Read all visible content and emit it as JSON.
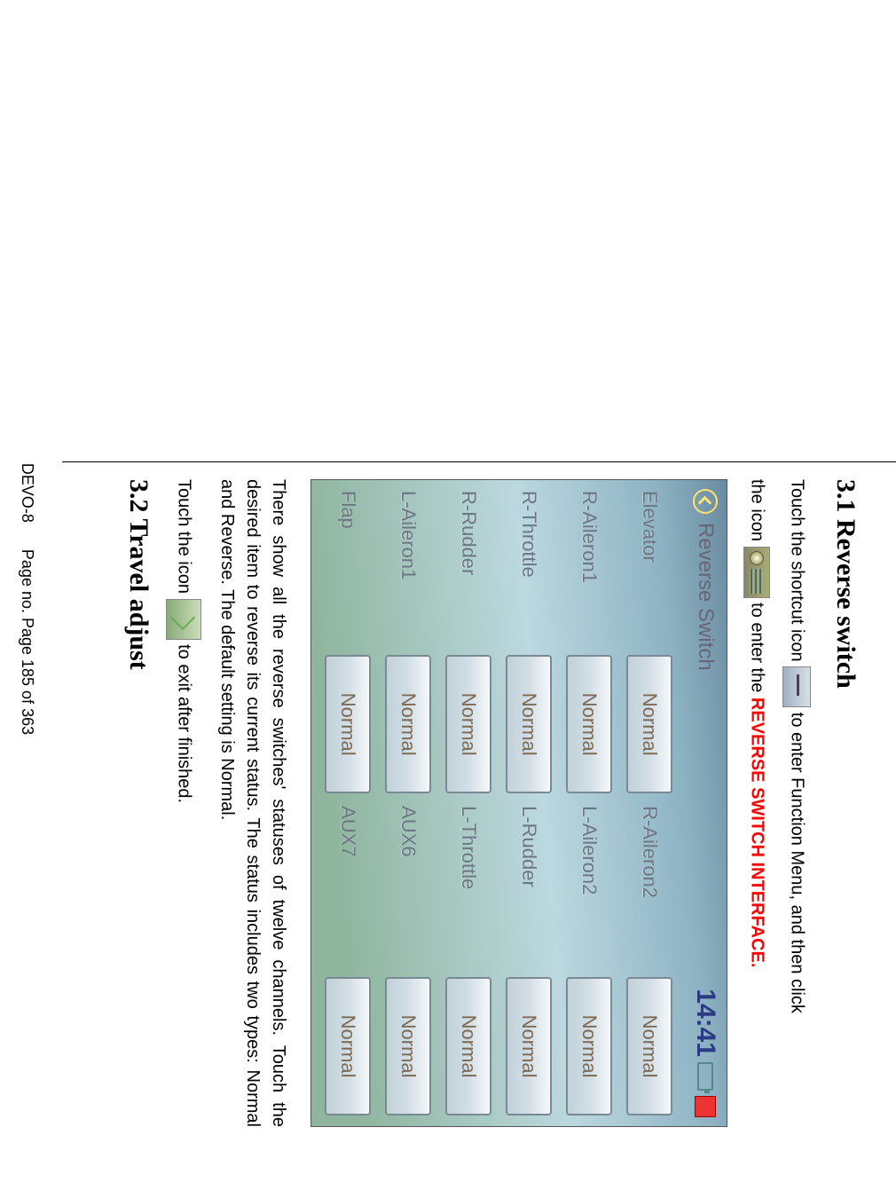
{
  "headings": {
    "h31": "3.1 Reverse switch",
    "h32": "3.2 Travel adjust"
  },
  "para": {
    "p1a": "Touch the shortcut icon ",
    "p1b": " to enter Function Menu, and then click",
    "p2a": "the icon ",
    "p2b": " to enter the ",
    "p2c": "REVERSE SWITCH INTERFACE.",
    "p3": "There show all the reverse switches' statuses of twelve channels. Touch the desired item to reverse its current status. The status includes two types: Normal and Reverse. The default setting is Normal.",
    "p4a": "Touch the icon ",
    "p4b": " to exit after finished."
  },
  "screen": {
    "title": "Reverse Switch",
    "clock": "14:41",
    "rows": [
      {
        "l": "Elevator",
        "v1": "Normal",
        "r": "R-Aileron2",
        "v2": "Normal"
      },
      {
        "l": "R-Aileron1",
        "v1": "Normal",
        "r": "L-Aileron2",
        "v2": "Normal"
      },
      {
        "l": "R-Throttle",
        "v1": "Normal",
        "r": "L-Rudder",
        "v2": "Normal"
      },
      {
        "l": "R-Rudder",
        "v1": "Normal",
        "r": "L-Throttle",
        "v2": "Normal"
      },
      {
        "l": "L-Aileron1",
        "v1": "Normal",
        "r": "AUX6",
        "v2": "Normal"
      },
      {
        "l": "Flap",
        "v1": "Normal",
        "r": "AUX7",
        "v2": "Normal"
      }
    ]
  },
  "footer": {
    "left": "DEVO-8",
    "right": "Page no. Page 185 of 363"
  }
}
